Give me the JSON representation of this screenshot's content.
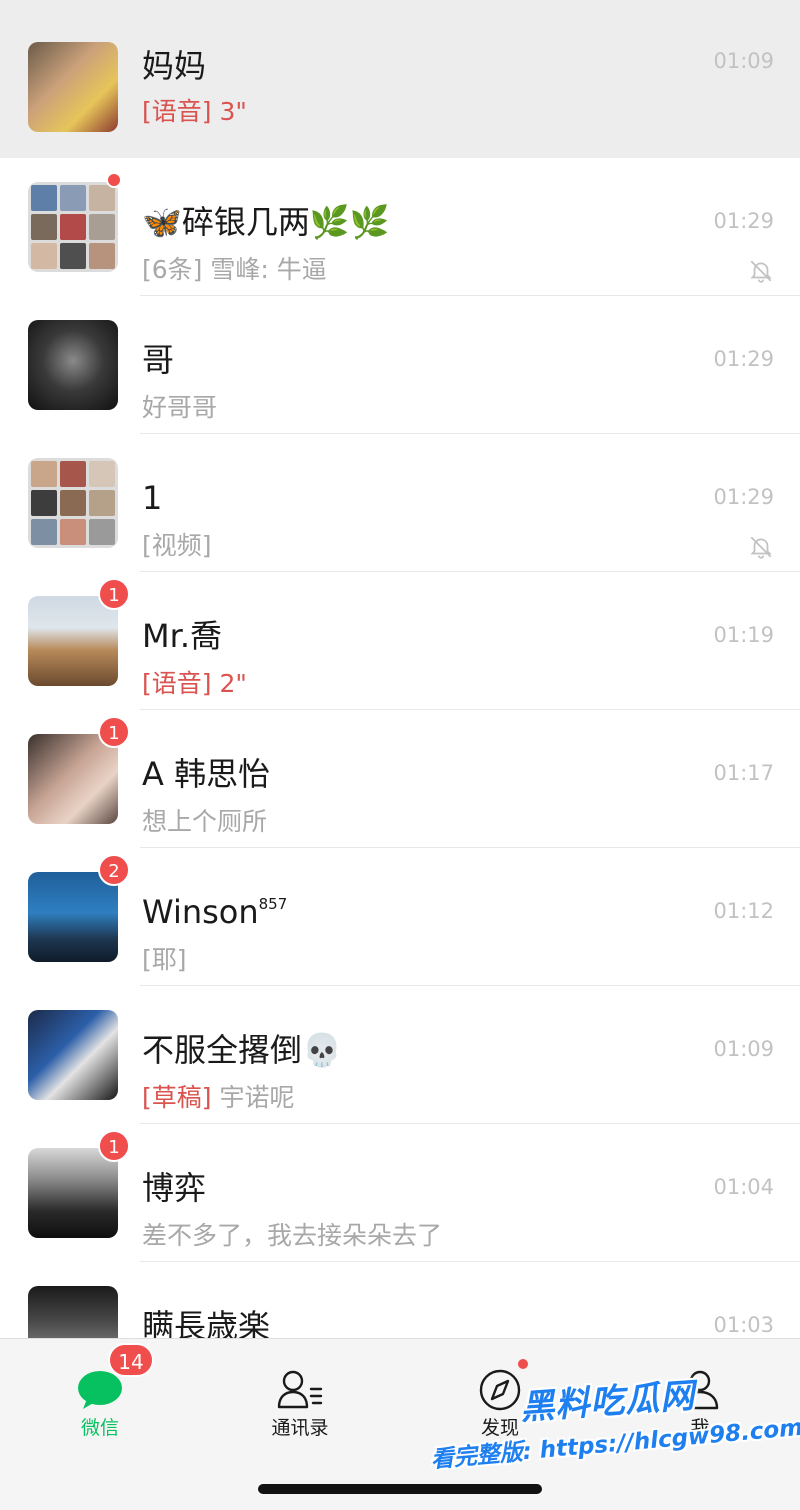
{
  "chats": [
    {
      "name": "妈妈",
      "preview_tag": "[语音] 3\"",
      "preview_text": "",
      "time": "01:09",
      "badge": "",
      "pinned": true,
      "muted": false
    },
    {
      "name": "🦋碎银几两🌿🌿",
      "preview_tag": "",
      "preview_text": "[6条] 雪峰: 牛逼",
      "time": "01:29",
      "badge": "",
      "dot": true,
      "pinned": false,
      "muted": true
    },
    {
      "name": "哥",
      "preview_tag": "",
      "preview_text": "好哥哥",
      "time": "01:29",
      "badge": "",
      "pinned": false,
      "muted": false
    },
    {
      "name": "1",
      "preview_tag": "",
      "preview_text": "[视频]",
      "time": "01:29",
      "badge": "",
      "pinned": false,
      "muted": true
    },
    {
      "name": "Mr.喬",
      "preview_tag": "[语音] 2\"",
      "preview_text": "",
      "time": "01:19",
      "badge": "1",
      "pinned": false,
      "muted": false
    },
    {
      "name": "A 韩思怡",
      "preview_tag": "",
      "preview_text": "想上个厕所",
      "time": "01:17",
      "badge": "1",
      "pinned": false,
      "muted": false
    },
    {
      "name": "Winson",
      "name_sup": "857",
      "preview_tag": "",
      "preview_text": "[耶]",
      "time": "01:12",
      "badge": "2",
      "pinned": false,
      "muted": false
    },
    {
      "name": "不服全撂倒💀",
      "preview_tag": "[草稿]",
      "preview_text": " 宇诺呢",
      "time": "01:09",
      "badge": "",
      "pinned": false,
      "muted": false
    },
    {
      "name": "博弈",
      "preview_tag": "",
      "preview_text": "差不多了，我去接朵朵去了",
      "time": "01:04",
      "badge": "1",
      "pinned": false,
      "muted": false
    },
    {
      "name": "瞒長歳楽",
      "preview_tag": "",
      "preview_text": "",
      "time": "01:03",
      "badge": "",
      "pinned": false,
      "muted": false
    }
  ],
  "tabs": [
    {
      "label": "微信",
      "badge": "14",
      "icon": "chat-bubble-icon"
    },
    {
      "label": "通讯录",
      "icon": "contacts-icon"
    },
    {
      "label": "发现",
      "icon": "compass-icon",
      "dot": true
    },
    {
      "label": "我",
      "icon": "person-icon"
    }
  ],
  "watermark": {
    "title": "黑料吃瓜网",
    "url": "看完整版: https://hlcgw98.com"
  },
  "colors": {
    "accent_green": "#07c160",
    "badge_red": "#f04d4d",
    "tag_red": "#d9534f",
    "pinned_bg": "#ededed",
    "watermark_blue": "#1e7ff0"
  }
}
